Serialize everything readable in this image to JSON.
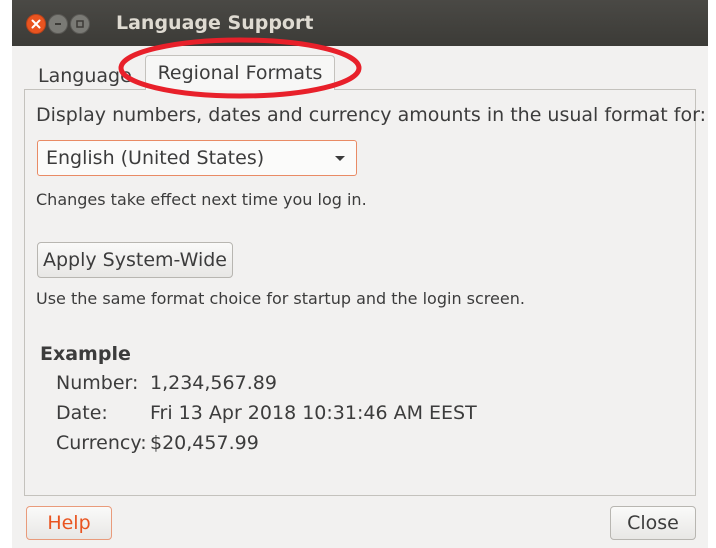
{
  "window": {
    "title": "Language Support",
    "buttons": {
      "close": "×",
      "minimize": "–",
      "maximize": "□"
    }
  },
  "tabs": [
    {
      "label": "Language",
      "selected": false
    },
    {
      "label": "Regional Formats",
      "selected": true
    }
  ],
  "regional": {
    "lead": "Display numbers, dates and currency amounts in the usual format for:",
    "locale_selected": "English (United States)",
    "hint_logout": "Changes take effect next time you log in.",
    "apply_button": "Apply System-Wide",
    "hint_system": "Use the same format choice for startup and the login screen."
  },
  "example": {
    "heading": "Example",
    "rows": [
      {
        "label": "Number:",
        "value": "1,234,567.89"
      },
      {
        "label": "Date:",
        "value": "Fri 13 Apr 2018 10:31:46 AM EEST"
      },
      {
        "label": "Currency:",
        "value": "$20,457.99"
      }
    ]
  },
  "footer": {
    "help": "Help",
    "close": "Close"
  },
  "colors": {
    "accent": "#e95420",
    "annotation": "#e8202a",
    "titlebar": "#3c3b37"
  }
}
